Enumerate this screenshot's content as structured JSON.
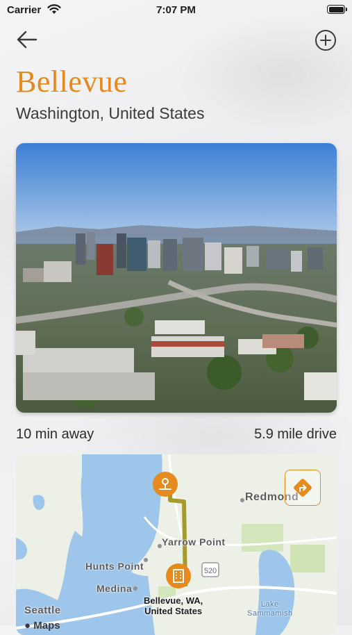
{
  "status_bar": {
    "carrier": "Carrier",
    "time": "7:07 PM"
  },
  "header": {
    "city": "Bellevue",
    "region": "Washington, United States"
  },
  "trip": {
    "eta": "10 min away",
    "distance": "5.9 mile drive"
  },
  "map": {
    "labels": {
      "redmond": "Redmond",
      "yarrow_point": "Yarrow Point",
      "hunts_point": "Hunts Point",
      "medina": "Medina",
      "seattle": "Seattle",
      "lake_sammamish": "Lake\nSammamish",
      "highway": "520"
    },
    "destination": {
      "line1": "Bellevue, WA,",
      "line2": "United States"
    },
    "credit": "Maps"
  },
  "icons": {
    "back": "arrow-left-icon",
    "add": "plus-circle-icon",
    "origin_pin": "location-pin-icon",
    "destination_pin": "building-pin-icon",
    "directions": "directions-arrow-icon"
  },
  "colors": {
    "accent": "#e68a1e",
    "route": "#a59a2a"
  }
}
